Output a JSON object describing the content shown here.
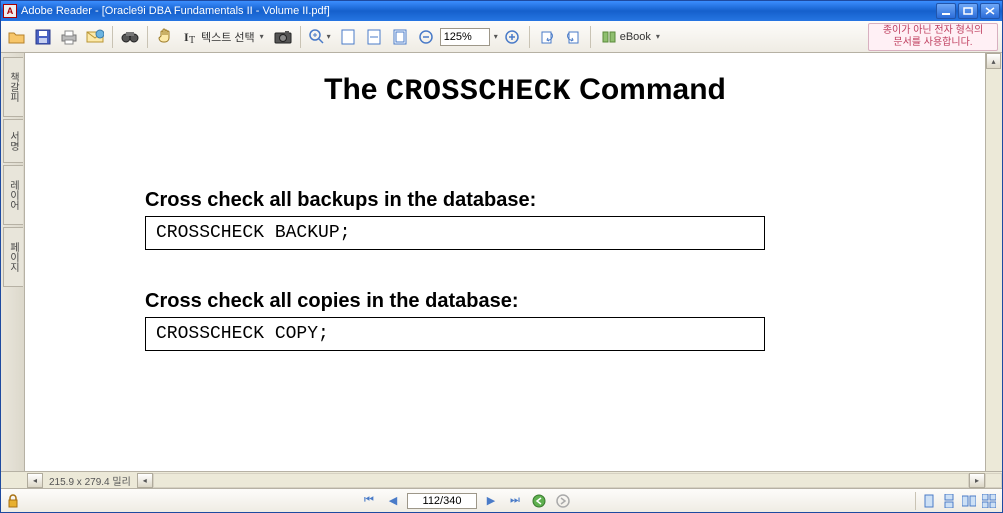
{
  "window": {
    "app_icon_letter": "A",
    "title": "Adobe Reader - [Oracle9i DBA Fundamentals II - Volume II.pdf]"
  },
  "toolbar": {
    "text_select_label": "텍스트 선택",
    "zoom_value": "125%",
    "ebook_label": "eBook",
    "notice_line1": "종이가 아닌 전자 형식의",
    "notice_line2": "문서를 사용합니다."
  },
  "sidepanel": {
    "tab1": "책갈피",
    "tab2": "서명",
    "tab3": "레이어",
    "tab4": "페이지"
  },
  "document": {
    "title_pre": "The ",
    "title_mono": "CROSSCHECK",
    "title_post": " Command",
    "section1_heading": "Cross check all backups in the database:",
    "section1_code": "CROSSCHECK BACKUP;",
    "section2_heading": "Cross check all copies in the database:",
    "section2_code": "CROSSCHECK COPY;"
  },
  "hscroll": {
    "page_dim": "215.9 x 279.4 밀리"
  },
  "navbar": {
    "page_indicator": "112/340"
  }
}
